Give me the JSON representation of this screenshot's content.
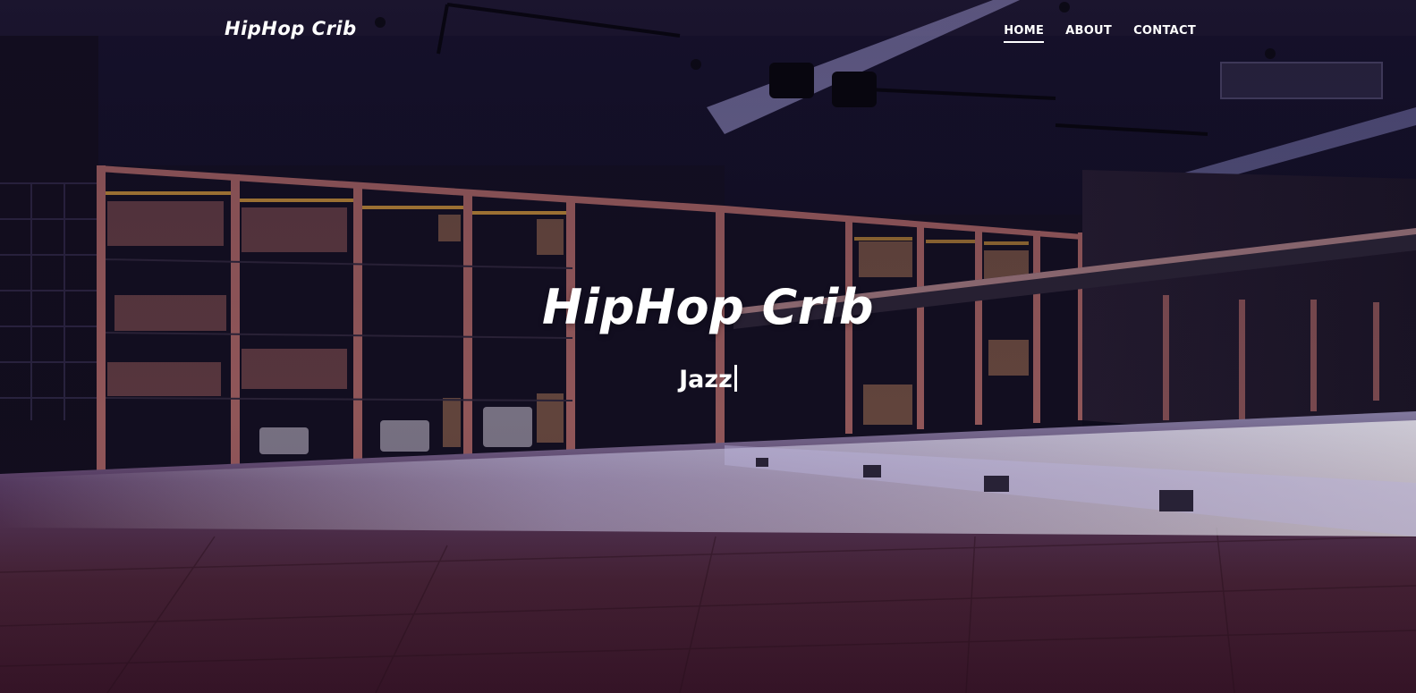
{
  "brand": {
    "name": "HipHop Crib"
  },
  "nav": {
    "items": [
      {
        "label": "HOME",
        "active": true
      },
      {
        "label": "ABOUT",
        "active": false
      },
      {
        "label": "CONTACT",
        "active": false
      }
    ]
  },
  "hero": {
    "title": "HipHop Crib",
    "typed_text": "Jazz",
    "background": "dance-studio-photo"
  },
  "colors": {
    "text": "#ffffff",
    "overlay": "#1a1030",
    "wood_floor": "#6b2c2a",
    "shelf_frame": "#b06a68",
    "shelf_light": "#e0a640"
  }
}
